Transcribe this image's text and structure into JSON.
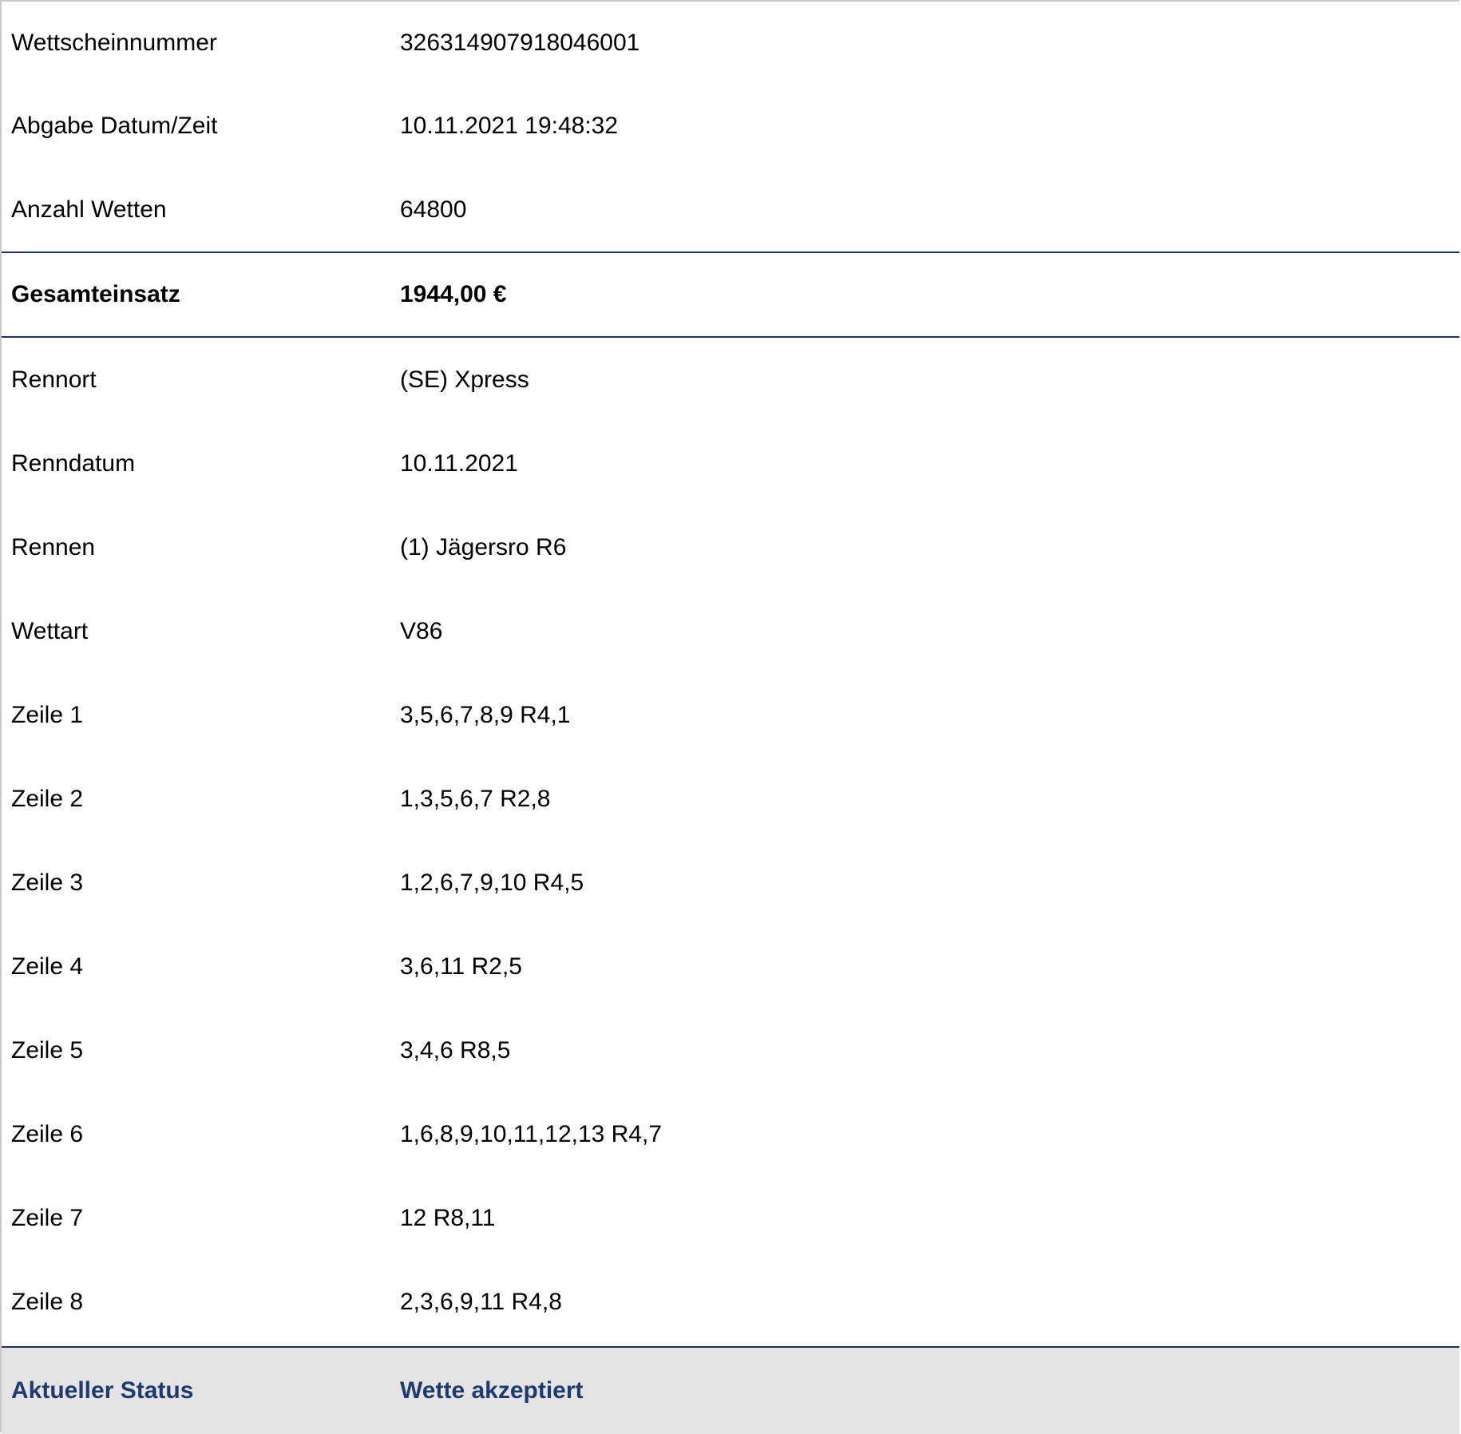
{
  "colors": {
    "divider": "#1e3060",
    "status_text": "#1e3a6e",
    "status_bg": "#e4e4e4"
  },
  "ticket": {
    "top_rows": [
      {
        "label": "Wettscheinnummer",
        "value": "326314907918046001"
      },
      {
        "label": "Abgabe Datum/Zeit",
        "value": "10.11.2021 19:48:32"
      },
      {
        "label": "Anzahl Wetten",
        "value": "64800"
      }
    ],
    "total": {
      "label": "Gesamteinsatz",
      "value": "1944,00 €"
    },
    "detail_rows": [
      {
        "label": "Rennort",
        "value": "(SE) Xpress"
      },
      {
        "label": "Renndatum",
        "value": "10.11.2021"
      },
      {
        "label": "Rennen",
        "value": "(1) Jägersro R6"
      },
      {
        "label": "Wettart",
        "value": "V86"
      },
      {
        "label": "Zeile 1",
        "value": "3,5,6,7,8,9 R4,1"
      },
      {
        "label": "Zeile 2",
        "value": "1,3,5,6,7 R2,8"
      },
      {
        "label": "Zeile 3",
        "value": "1,2,6,7,9,10 R4,5"
      },
      {
        "label": "Zeile 4",
        "value": "3,6,11 R2,5"
      },
      {
        "label": "Zeile 5",
        "value": "3,4,6 R8,5"
      },
      {
        "label": "Zeile 6",
        "value": "1,6,8,9,10,11,12,13 R4,7"
      },
      {
        "label": "Zeile 7",
        "value": "12 R8,11"
      },
      {
        "label": "Zeile 8",
        "value": "2,3,6,9,11 R4,8"
      }
    ],
    "status": {
      "label": "Aktueller Status",
      "value": "Wette akzeptiert"
    }
  }
}
